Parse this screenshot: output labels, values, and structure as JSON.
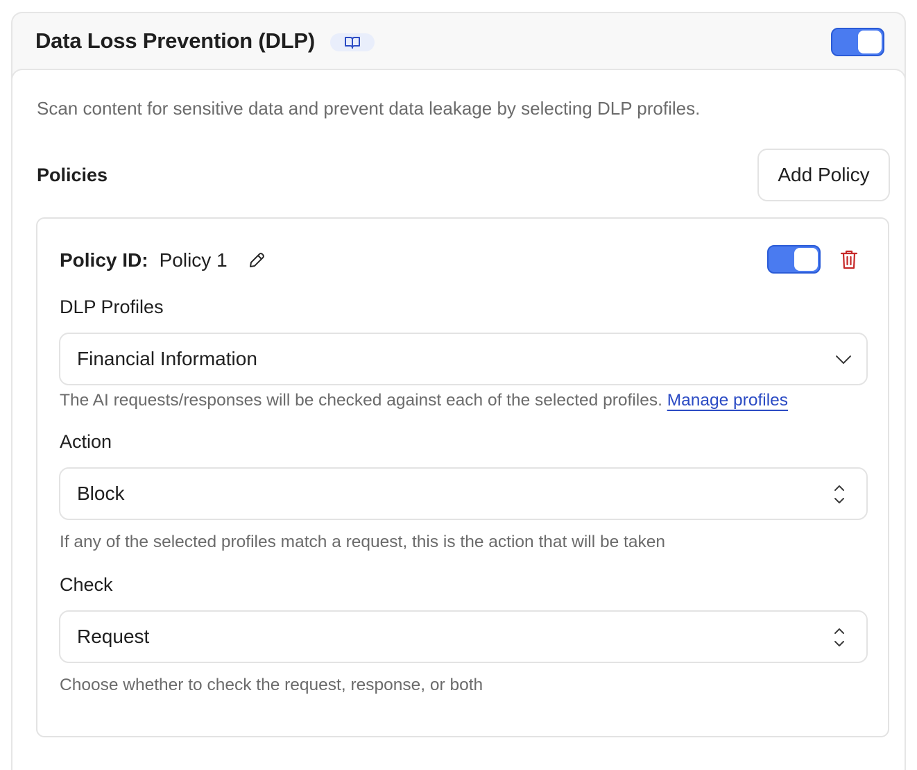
{
  "header": {
    "title": "Data Loss Prevention (DLP)",
    "docs_icon": "book-icon",
    "enabled": true
  },
  "body": {
    "description": "Scan content for sensitive data and prevent data leakage by selecting DLP profiles.",
    "policies_title": "Policies",
    "add_policy_label": "Add Policy"
  },
  "policy": {
    "id_label": "Policy ID:",
    "id_value": "Policy 1",
    "enabled": true,
    "profiles_label": "DLP Profiles",
    "profiles_value": "Financial Information",
    "profiles_help": "The AI requests/responses will be checked against each of the selected profiles.",
    "manage_profiles_link": "Manage profiles",
    "action_label": "Action",
    "action_value": "Block",
    "action_help": "If any of the selected profiles match a request, this is the action that will be taken",
    "check_label": "Check",
    "check_value": "Request",
    "check_help": "Choose whether to check the request, response, or both"
  },
  "colors": {
    "toggle_on": "#4a7bf0",
    "link": "#2b4bc4",
    "danger": "#c62828"
  }
}
